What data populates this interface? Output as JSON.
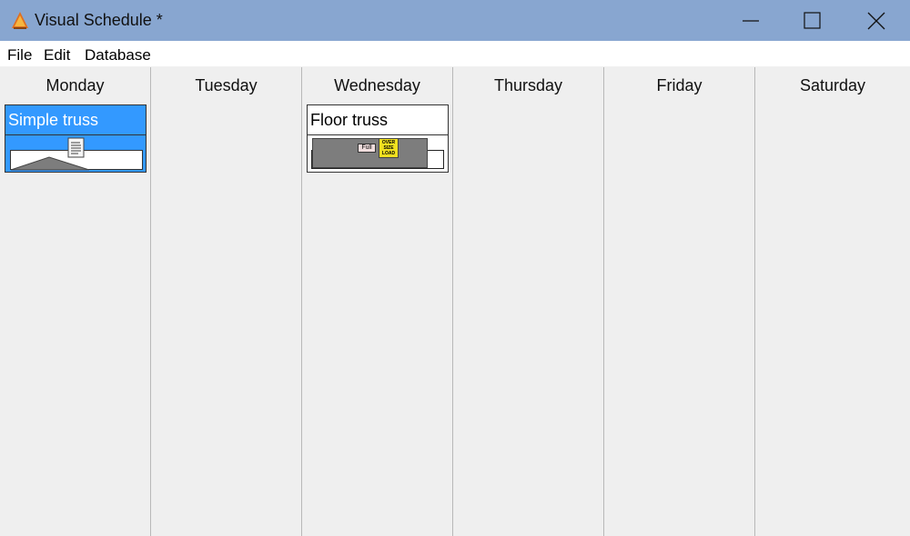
{
  "window": {
    "title": "Visual Schedule *",
    "accent_color": "#88a6d0"
  },
  "menu": {
    "items": [
      "File",
      "Edit",
      "Database"
    ]
  },
  "days": [
    "Monday",
    "Tuesday",
    "Wednesday",
    "Thursday",
    "Friday",
    "Saturday"
  ],
  "jobs": [
    {
      "day": "Monday",
      "title": "Simple truss",
      "selected": true,
      "icon": "document-icon",
      "color": "#3399ff"
    },
    {
      "day": "Wednesday",
      "title": "Floor truss",
      "selected": false,
      "badges": [
        "Full",
        "OVER SIZE LOAD"
      ],
      "color": "#ffffff"
    }
  ]
}
